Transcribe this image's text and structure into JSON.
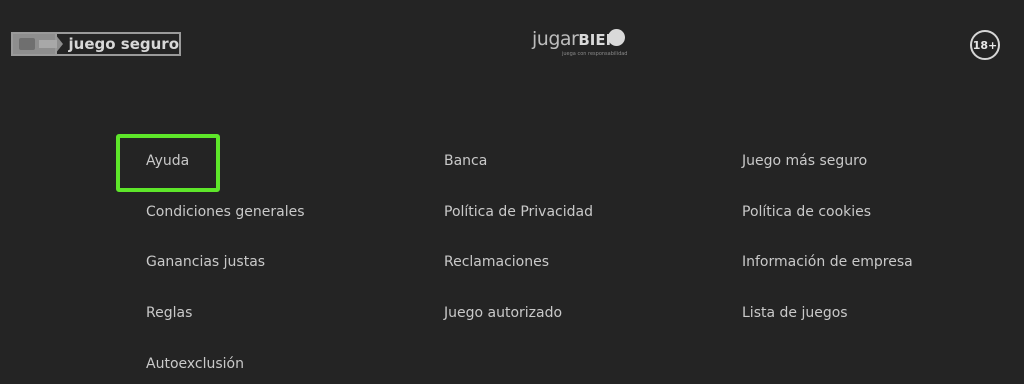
{
  "header": {
    "juego_seguro_text": "juego seguro",
    "jugarbien_light": "jugar",
    "jugarbien_bold": "BIEN",
    "jugarbien_tagline": "juega con responsabilidad",
    "age_badge": "18+"
  },
  "links": {
    "column1": [
      "Ayuda",
      "Condiciones generales",
      "Ganancias justas",
      "Reglas",
      "Autoexclusión"
    ],
    "column2": [
      "Banca",
      "Política de Privacidad",
      "Reclamaciones",
      "Juego autorizado"
    ],
    "column3": [
      "Juego más seguro",
      "Política de cookies",
      "Información de empresa",
      "Lista de juegos"
    ]
  },
  "colors": {
    "background": "#242424",
    "link_text": "#c9c9c9",
    "highlight": "#5ee62a"
  }
}
